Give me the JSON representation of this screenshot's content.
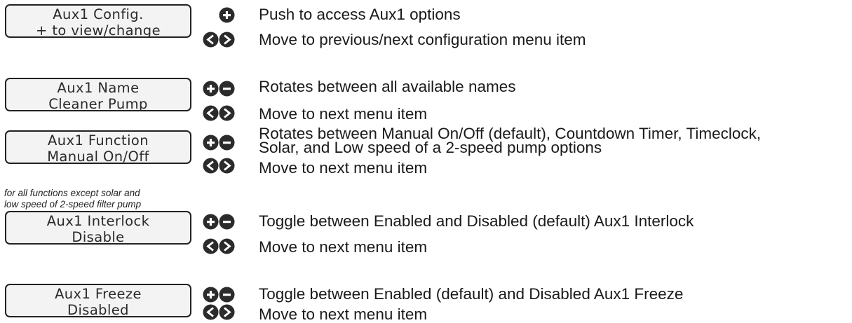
{
  "screens": [
    {
      "line1": "Aux1 Config.",
      "line2": "+ to view/change",
      "actions": [
        {
          "buttons": "plus",
          "text": "Push to access Aux1 options"
        },
        {
          "buttons": "left-right",
          "text": "Move to previous/next configuration menu item"
        }
      ]
    },
    {
      "line1": "Aux1 Name",
      "line2": "Cleaner Pump",
      "actions": [
        {
          "buttons": "plus-minus",
          "text": "Rotates between all available names"
        },
        {
          "buttons": "left-right",
          "text": "Move to next menu item"
        }
      ]
    },
    {
      "line1": "Aux1 Function",
      "line2": "Manual On/Off",
      "actions": [
        {
          "buttons": "plus-minus",
          "text_line1": "Rotates between Manual On/Off (default), Countdown Timer, Timeclock,",
          "text_line2": "Solar, and Low speed of a 2-speed pump options"
        },
        {
          "buttons": "left-right",
          "text": "Move to next menu item"
        }
      ]
    },
    {
      "note_line1": "for all functions except solar and",
      "note_line2": "low speed of 2-speed filter pump",
      "line1": "Aux1 Interlock",
      "line2": "Disable",
      "actions": [
        {
          "buttons": "plus-minus",
          "text": "Toggle between Enabled and Disabled (default) Aux1 Interlock"
        },
        {
          "buttons": "left-right",
          "text": "Move to next menu item"
        }
      ]
    },
    {
      "line1": "Aux1 Freeze",
      "line2": "Disabled",
      "actions": [
        {
          "buttons": "plus-minus",
          "text": "Toggle between Enabled (default) and Disabled  Aux1 Freeze"
        },
        {
          "buttons": "left-right",
          "text": "Move to next menu item"
        }
      ]
    }
  ],
  "icons": {
    "plus": "plus-button-icon",
    "minus": "minus-button-icon",
    "left": "left-arrow-button-icon",
    "right": "right-arrow-button-icon"
  },
  "colors": {
    "button_fill": "#2b2b2b",
    "lcd_background": "#f3f3f3",
    "text": "#1a1a1a"
  }
}
